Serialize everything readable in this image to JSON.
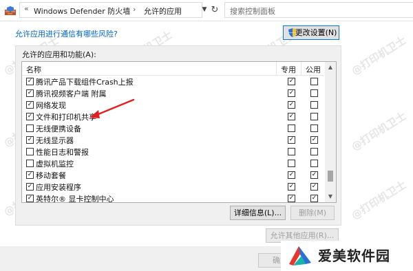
{
  "addressbar": {
    "breadcrumb_prev_glyph": "«",
    "crumbs": [
      "Windows Defender 防火墙",
      "允许的应用"
    ],
    "separator": "›",
    "search_placeholder": "搜索控制面板"
  },
  "risk_link": "允许应用进行通信有哪些风险?",
  "change_settings_label": "更改设置(N)",
  "group_label": "允许的应用和功能(A):",
  "columns": {
    "name": "名称",
    "private": "专用",
    "public": "公用"
  },
  "apps": [
    {
      "name": "腾讯产品下载组件Crash上报",
      "enabled": true,
      "private": true,
      "public": false
    },
    {
      "name": "腾讯视频客户端 附属",
      "enabled": true,
      "private": true,
      "public": false
    },
    {
      "name": "网络发现",
      "enabled": true,
      "private": true,
      "public": false
    },
    {
      "name": "文件和打印机共享",
      "enabled": true,
      "private": true,
      "public": false
    },
    {
      "name": "无线便携设备",
      "enabled": false,
      "private": false,
      "public": false
    },
    {
      "name": "无线显示器",
      "enabled": true,
      "private": true,
      "public": true
    },
    {
      "name": "性能日志和警报",
      "enabled": false,
      "private": false,
      "public": false
    },
    {
      "name": "虚拟机监控",
      "enabled": false,
      "private": false,
      "public": false
    },
    {
      "name": "移动套餐",
      "enabled": true,
      "private": true,
      "public": true
    },
    {
      "name": "应用安装程序",
      "enabled": true,
      "private": true,
      "public": true
    },
    {
      "name": "英特尔® 显卡控制中心",
      "enabled": true,
      "private": true,
      "public": true
    }
  ],
  "details_label": "详细信息(L)...",
  "delete_label": "删除(M)",
  "allow_other_label": "允许其他应用(R)...",
  "ok_label": "确定",
  "brand_text": "爱美软件园",
  "watermark_text": "@打印机卫士",
  "colors": {
    "link": "#0066cc",
    "arrow": "#e02020",
    "brand_red": "#e8352c",
    "brand_blue": "#2a6fd6",
    "brand_teal": "#18b3a8"
  }
}
